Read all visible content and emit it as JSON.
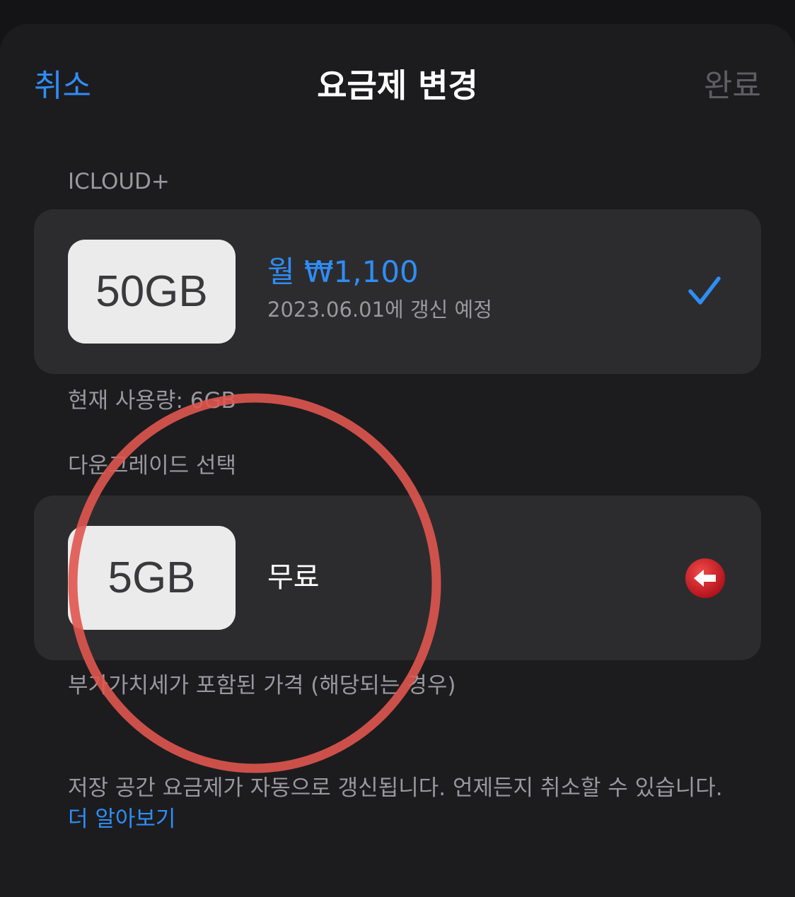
{
  "nav": {
    "cancel_label": "취소",
    "title": "요금제 변경",
    "done_label": "완료"
  },
  "current_plan": {
    "section_label": "ICLOUD+",
    "size": "50GB",
    "price": "월 ₩1,100",
    "renewal": "2023.06.01에 갱신 예정",
    "selected": true,
    "usage_text": "현재 사용량: 6GB"
  },
  "downgrade": {
    "section_label": "다운그레이드 선택",
    "size": "5GB",
    "price": "무료",
    "vat_note": "부가가치세가 포함된 가격 (해당되는 경우)"
  },
  "footer": {
    "text": "저장 공간 요금제가 자동으로 갱신됩니다. 언제든지 취소할 수 있습니다. ",
    "link_label": "더 알아보기"
  },
  "colors": {
    "accent": "#2f8df7",
    "background": "#1c1c1e",
    "card": "#2c2c2e",
    "annotation_circle": "#e0564f",
    "downgrade_icon": "#d4242c"
  },
  "icons": {
    "selected": "checkmark-icon",
    "downgrade": "left-arrow-circle-icon"
  }
}
